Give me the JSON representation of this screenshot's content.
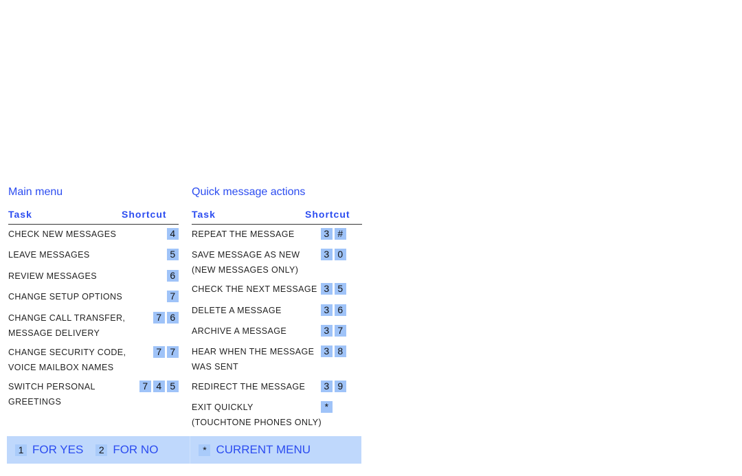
{
  "main_menu": {
    "title": "Main menu",
    "col_task": "Task",
    "col_shortcut": "Shortcut",
    "rows": [
      {
        "lines": [
          "CHECK NEW MESSAGES"
        ],
        "keys": [
          "4"
        ]
      },
      {
        "lines": [
          "LEAVE MESSAGES"
        ],
        "keys": [
          "5"
        ]
      },
      {
        "lines": [
          "REVIEW MESSAGES"
        ],
        "keys": [
          "6"
        ]
      },
      {
        "lines": [
          "CHANGE SETUP OPTIONS"
        ],
        "keys": [
          "7"
        ]
      },
      {
        "lines": [
          "CHANGE CALL TRANSFER,",
          "MESSAGE DELIVERY"
        ],
        "keys": [
          "7",
          "6"
        ]
      },
      {
        "lines": [
          "CHANGE SECURITY CODE,",
          "VOICE MAILBOX NAMES"
        ],
        "keys": [
          "7",
          "7"
        ]
      },
      {
        "lines": [
          "SWITCH PERSONAL",
          "GREETINGS"
        ],
        "keys": [
          "7",
          "4",
          "5"
        ]
      }
    ]
  },
  "quick_actions": {
    "title": "Quick message actions",
    "col_task": "Task",
    "col_shortcut": "Shortcut",
    "rows": [
      {
        "lines": [
          "REPEAT THE MESSAGE"
        ],
        "keys": [
          "3",
          "#"
        ]
      },
      {
        "lines": [
          "SAVE MESSAGE AS NEW",
          "(NEW MESSAGES ONLY)"
        ],
        "keys": [
          "3",
          "0"
        ]
      },
      {
        "lines": [
          "CHECK THE NEXT MESSAGE"
        ],
        "keys": [
          "3",
          "5"
        ]
      },
      {
        "lines": [
          "DELETE A MESSAGE"
        ],
        "keys": [
          "3",
          "6"
        ]
      },
      {
        "lines": [
          "ARCHIVE A MESSAGE"
        ],
        "keys": [
          "3",
          "7"
        ]
      },
      {
        "lines": [
          "HEAR WHEN THE MESSAGE",
          "WAS SENT"
        ],
        "keys": [
          "3",
          "8"
        ]
      },
      {
        "lines": [
          "REDIRECT THE MESSAGE"
        ],
        "keys": [
          "3",
          "9"
        ]
      },
      {
        "lines": [
          "EXIT QUICKLY",
          "(TOUCHTONE PHONES ONLY)"
        ],
        "keys": [
          "*"
        ]
      }
    ]
  },
  "footer": {
    "yes_key": "1",
    "yes_label": "FOR YES",
    "no_key": "2",
    "no_label": "FOR NO",
    "menu_key": "*",
    "menu_label": "CURRENT MENU"
  },
  "colors": {
    "accent": "#2b4cf0",
    "key_bg": "#9fc3f8",
    "footer_bg": "#bfd8fc"
  }
}
